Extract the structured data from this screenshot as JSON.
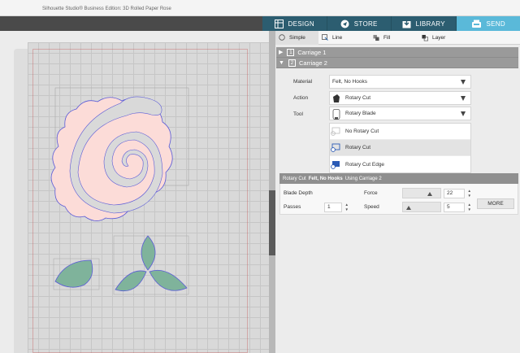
{
  "window": {
    "title": "Silhouette Studio® Business Edition: 3D Rolled Paper Rose"
  },
  "nav": {
    "tabs": [
      {
        "label": "DESIGN",
        "icon": "design-grid-icon",
        "active": false
      },
      {
        "label": "STORE",
        "icon": "store-icon",
        "active": false
      },
      {
        "label": "LIBRARY",
        "icon": "library-icon",
        "active": false
      },
      {
        "label": "SEND",
        "icon": "send-icon",
        "active": true
      }
    ]
  },
  "send_panel": {
    "modes": [
      {
        "label": "Simple",
        "icon": "simple-mode-icon",
        "active": true
      },
      {
        "label": "Line",
        "icon": "line-mode-icon",
        "active": false
      },
      {
        "label": "Fill",
        "icon": "fill-mode-icon",
        "active": false
      },
      {
        "label": "Layer",
        "icon": "layer-mode-icon",
        "active": false
      }
    ],
    "carriage1": {
      "number": "1",
      "label": "Carriage 1",
      "expanded": false
    },
    "carriage2": {
      "number": "2",
      "label": "Carriage 2",
      "expanded": true,
      "material_label": "Material",
      "material_value": "Felt, No Hooks",
      "action_label": "Action",
      "action_value": "Rotary Cut",
      "tool_label": "Tool",
      "tool_value": "Rotary Blade",
      "action_options": [
        {
          "label": "No Rotary Cut",
          "selected": false
        },
        {
          "label": "Rotary Cut",
          "selected": true
        },
        {
          "label": "Rotary Cut Edge",
          "selected": false
        }
      ]
    },
    "settings": {
      "header_prefix": "Rotary Cut",
      "header_material": "Felt, No Hooks",
      "header_suffix": "Using Carriage 2",
      "blade_depth_label": "Blade Depth",
      "force_label": "Force",
      "force_value": "22",
      "passes_label": "Passes",
      "passes_value": "1",
      "speed_label": "Speed",
      "speed_value": "5",
      "more_label": "MORE"
    }
  },
  "colors": {
    "accent_active_tab": "#5ab9d9",
    "nav_tab_bg": "#2c5d70",
    "rose_fill": "#fcdcd8",
    "leaf_fill": "#7fb39b",
    "cut_line": "#5a5ad8"
  }
}
